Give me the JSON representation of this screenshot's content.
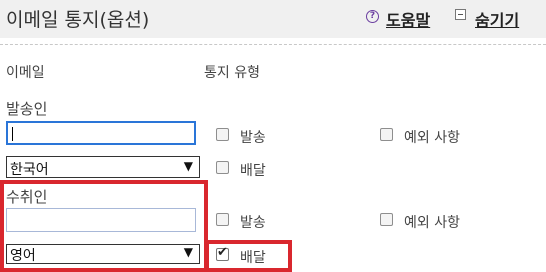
{
  "header": {
    "title": "이메일 통지(옵션)",
    "help_label": "도움말",
    "help_icon": "question-circle-icon",
    "collapse_label": "숨기기",
    "collapse_icon": "collapse-box-icon"
  },
  "columns": {
    "email": "이메일",
    "notify_type": "통지 유형"
  },
  "sender": {
    "label": "발송인",
    "email_value": "",
    "language": "한국어",
    "options": {
      "send": "발송",
      "deliver": "배달",
      "exception": "예외 사항"
    },
    "checked": {
      "send": false,
      "deliver": false,
      "exception": false
    }
  },
  "recipient": {
    "label": "수취인",
    "email_value": "",
    "language": "영어",
    "options": {
      "send": "발송",
      "deliver": "배달",
      "exception": "예외 사항"
    },
    "checked": {
      "send": false,
      "deliver": true,
      "exception": false
    }
  },
  "colors": {
    "highlight": "#d9272e",
    "focus_border": "#2a75d8",
    "header_bg": "#f0f0f0"
  }
}
